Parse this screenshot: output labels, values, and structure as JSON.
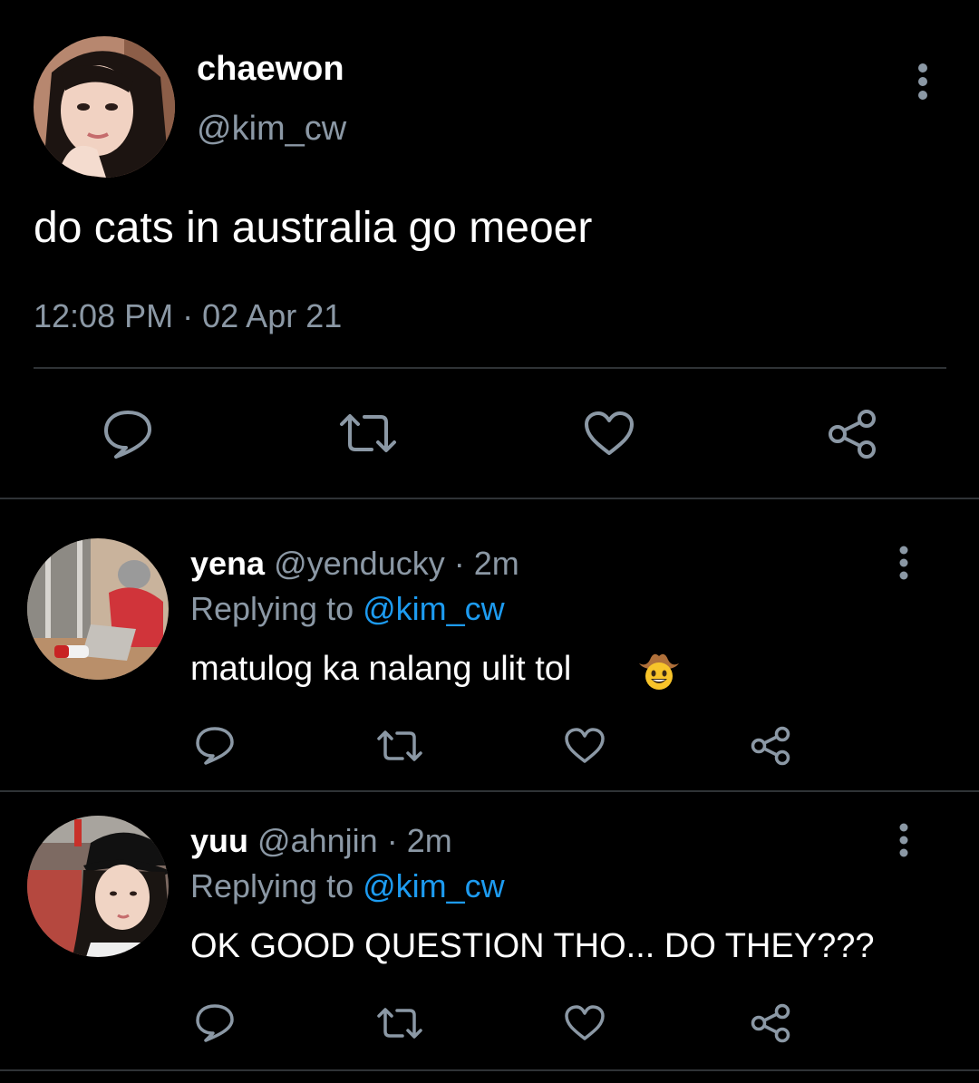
{
  "main_tweet": {
    "display_name": "chaewon",
    "handle": "@kim_cw",
    "text": "do cats in australia go meoer",
    "time": "12:08 PM",
    "separator": "·",
    "date": "02 Apr 21"
  },
  "replies": [
    {
      "display_name": "yena",
      "handle": "@yenducky",
      "dot": "·",
      "age": "2m",
      "replying_prefix": "Replying to",
      "replying_to": "@kim_cw",
      "text": "matulog ka nalang ulit tol",
      "emoji": "cowboy-face-emoji"
    },
    {
      "display_name": "yuu",
      "handle": "@ahnjin",
      "dot": "·",
      "age": "2m",
      "replying_prefix": "Replying to",
      "replying_to": "@kim_cw",
      "text": "OK GOOD QUESTION THO... DO THEY???"
    }
  ],
  "action_icons": [
    "reply-icon",
    "retweet-icon",
    "like-icon",
    "share-icon"
  ],
  "menu_icon": "more-vertical-icon",
  "colors": {
    "background": "#000000",
    "text_primary": "#ffffff",
    "text_secondary": "#8b98a5",
    "mention": "#1d9bf0",
    "divider": "#2f3336",
    "icon": "#8b98a5"
  }
}
